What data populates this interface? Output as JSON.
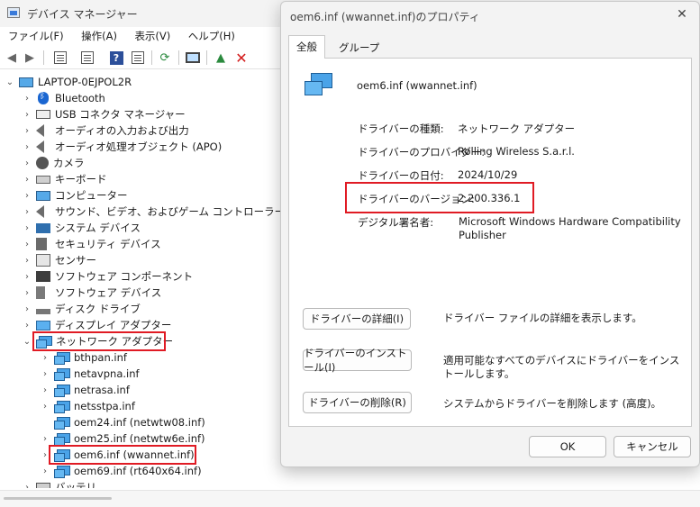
{
  "device_manager": {
    "title": "デバイス マネージャー",
    "menu": [
      "ファイル(F)",
      "操作(A)",
      "表示(V)",
      "ヘルプ(H)"
    ],
    "toolbar_icons": [
      "back-arrow-icon",
      "forward-arrow-icon",
      "properties-icon",
      "details-icon",
      "help-icon",
      "view-icon",
      "update-driver-icon",
      "scan-hardware-icon",
      "enable-device-icon",
      "uninstall-x-icon"
    ],
    "computer": "LAPTOP-0EJPOL2R",
    "categories": [
      {
        "label": "Bluetooth",
        "icon": "bluetooth-icon"
      },
      {
        "label": "USB コネクタ マネージャー",
        "icon": "usb-icon"
      },
      {
        "label": "オーディオの入力および出力",
        "icon": "speaker-icon"
      },
      {
        "label": "オーディオ処理オブジェクト (APO)",
        "icon": "speaker-icon"
      },
      {
        "label": "カメラ",
        "icon": "camera-icon"
      },
      {
        "label": "キーボード",
        "icon": "keyboard-icon"
      },
      {
        "label": "コンピューター",
        "icon": "computer-icon"
      },
      {
        "label": "サウンド、ビデオ、およびゲーム コントローラー",
        "icon": "speaker-icon"
      },
      {
        "label": "システム デバイス",
        "icon": "system-icon"
      },
      {
        "label": "セキュリティ デバイス",
        "icon": "security-icon"
      },
      {
        "label": "センサー",
        "icon": "sensor-icon"
      },
      {
        "label": "ソフトウェア コンポーネント",
        "icon": "software-icon"
      },
      {
        "label": "ソフトウェア デバイス",
        "icon": "software-device-icon"
      },
      {
        "label": "ディスク ドライブ",
        "icon": "disk-icon"
      },
      {
        "label": "ディスプレイ アダプター",
        "icon": "display-icon"
      },
      {
        "label": "ネットワーク アダプター",
        "icon": "network-icon"
      }
    ],
    "network_children": [
      "bthpan.inf",
      "netavpna.inf",
      "netrasa.inf",
      "netsstpa.inf",
      "oem24.inf (netwtw08.inf)",
      "oem25.inf (netwtw6e.inf)",
      "oem6.inf (wwannet.inf)",
      "oem69.inf (rt640x64.inf)"
    ],
    "last_partial": "バッテリ"
  },
  "dialog": {
    "title": "oem6.inf (wwannet.inf)のプロパティ",
    "tabs": [
      "全般",
      "グループ"
    ],
    "driver_name": "oem6.inf (wwannet.inf)",
    "fields": [
      {
        "label": "ドライバーの種類:",
        "value": "ネットワーク アダプター"
      },
      {
        "label": "ドライバーのプロバイダー:",
        "value": "Rolling Wireless S.a.r.l."
      },
      {
        "label": "ドライバーの日付:",
        "value": "2024/10/29"
      },
      {
        "label": "ドライバーのバージョン:",
        "value": "2.200.336.1"
      },
      {
        "label": "デジタル署名者:",
        "value": "Microsoft Windows Hardware Compatibility Publisher"
      }
    ],
    "actions": [
      {
        "button": "ドライバーの詳細(I)",
        "desc": "ドライバー ファイルの詳細を表示します。"
      },
      {
        "button": "ドライバーのインストール(I)",
        "desc": "適用可能なすべてのデバイスにドライバーをインストールします。"
      },
      {
        "button": "ドライバーの削除(R)",
        "desc": "システムからドライバーを削除します (高度)。"
      }
    ],
    "ok": "OK",
    "cancel": "キャンセル",
    "highlight_color": "#e01b24"
  }
}
